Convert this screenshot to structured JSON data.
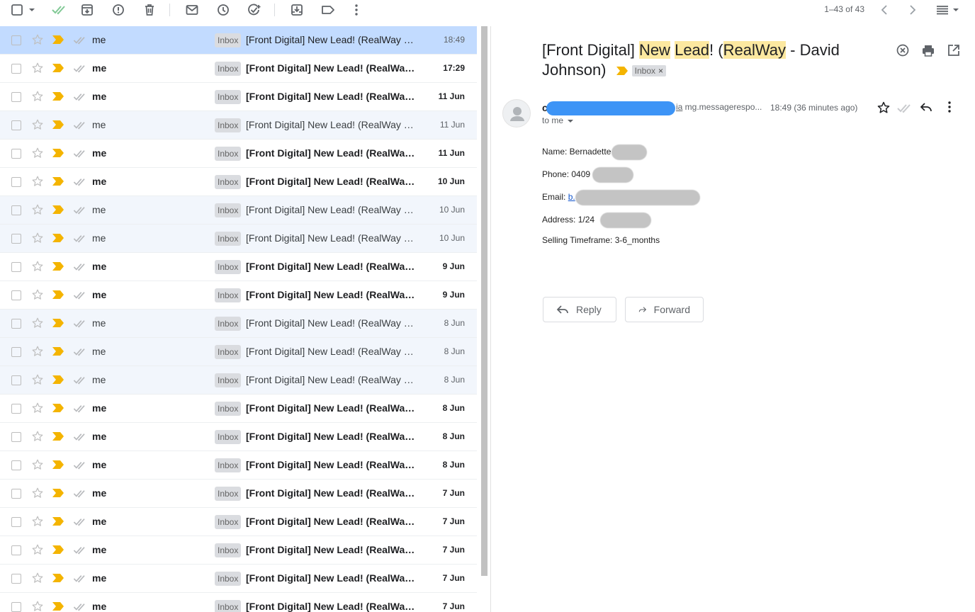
{
  "toolbar": {
    "pager_text": "1–43 of 43"
  },
  "emails": [
    {
      "sender": "me",
      "label": "Inbox",
      "subject": "[Front Digital] New Lead! (RealWay - David Johnson)",
      "date": "18:49",
      "state": "selected"
    },
    {
      "sender": "me",
      "label": "Inbox",
      "subject": "[Front Digital] New Lead! (RealWay - David Johnson)",
      "date": "17:29",
      "state": "unread"
    },
    {
      "sender": "me",
      "label": "Inbox",
      "subject": "[Front Digital] New Lead! (RealWay - David Johnson)",
      "date": "11 Jun",
      "state": "unread"
    },
    {
      "sender": "me",
      "label": "Inbox",
      "subject": "[Front Digital] New Lead! (RealWay - David Johnson)",
      "date": "11 Jun",
      "state": "read"
    },
    {
      "sender": "me",
      "label": "Inbox",
      "subject": "[Front Digital] New Lead! (RealWay - David Johnson)",
      "date": "11 Jun",
      "state": "unread"
    },
    {
      "sender": "me",
      "label": "Inbox",
      "subject": "[Front Digital] New Lead! (RealWay - David Johnson)",
      "date": "10 Jun",
      "state": "unread"
    },
    {
      "sender": "me",
      "label": "Inbox",
      "subject": "[Front Digital] New Lead! (RealWay - David Johnson)",
      "date": "10 Jun",
      "state": "read"
    },
    {
      "sender": "me",
      "label": "Inbox",
      "subject": "[Front Digital] New Lead! (RealWay - David Johnson)",
      "date": "10 Jun",
      "state": "read"
    },
    {
      "sender": "me",
      "label": "Inbox",
      "subject": "[Front Digital] New Lead! (RealWay - David Johnson)",
      "date": "9 Jun",
      "state": "unread"
    },
    {
      "sender": "me",
      "label": "Inbox",
      "subject": "[Front Digital] New Lead! (RealWay - David Johnson)",
      "date": "9 Jun",
      "state": "unread"
    },
    {
      "sender": "me",
      "label": "Inbox",
      "subject": "[Front Digital] New Lead! (RealWay - David Johnson)",
      "date": "8 Jun",
      "state": "read"
    },
    {
      "sender": "me",
      "label": "Inbox",
      "subject": "[Front Digital] New Lead! (RealWay - David Johnson)",
      "date": "8 Jun",
      "state": "read"
    },
    {
      "sender": "me",
      "label": "Inbox",
      "subject": "[Front Digital] New Lead! (RealWay - David Johnson)",
      "date": "8 Jun",
      "state": "read"
    },
    {
      "sender": "me",
      "label": "Inbox",
      "subject": "[Front Digital] New Lead! (RealWay - David Johnson)",
      "date": "8 Jun",
      "state": "unread"
    },
    {
      "sender": "me",
      "label": "Inbox",
      "subject": "[Front Digital] New Lead! (RealWay - David Johnson)",
      "date": "8 Jun",
      "state": "unread"
    },
    {
      "sender": "me",
      "label": "Inbox",
      "subject": "[Front Digital] New Lead! (RealWay - David Johnson)",
      "date": "8 Jun",
      "state": "unread"
    },
    {
      "sender": "me",
      "label": "Inbox",
      "subject": "[Front Digital] New Lead! (RealWay - David Johnson)",
      "date": "7 Jun",
      "state": "unread"
    },
    {
      "sender": "me",
      "label": "Inbox",
      "subject": "[Front Digital] New Lead! (RealWay - David Johnson)",
      "date": "7 Jun",
      "state": "unread"
    },
    {
      "sender": "me",
      "label": "Inbox",
      "subject": "[Front Digital] New Lead! (RealWay - David Johnson)",
      "date": "7 Jun",
      "state": "unread"
    },
    {
      "sender": "me",
      "label": "Inbox",
      "subject": "[Front Digital] New Lead! (RealWay - David Johnson)",
      "date": "7 Jun",
      "state": "unread"
    },
    {
      "sender": "me",
      "label": "Inbox",
      "subject": "[Front Digital] New Lead! (RealWay - David Johnson)",
      "date": "7 Jun",
      "state": "unread"
    }
  ],
  "reader": {
    "subject_prefix": "[Front Digital] ",
    "subject_hl1": "New",
    "subject_hl2": "Lead",
    "subject_mid": "! (",
    "subject_hl3": "RealWay",
    "subject_suffix": " - David Johnson)",
    "chip_label": "Inbox",
    "chip_close": "×",
    "from_visible": "c",
    "via_prefix": "ia",
    "via_domain": " mg.messagerespo...",
    "time": "18:49 (36 minutes ago)",
    "to": "to me",
    "body": {
      "name_label": "Name: Bernadette",
      "phone_label": "Phone: 0409",
      "email_label": "Email: ",
      "email_visible": "b.",
      "address_label": "Address: 1/24",
      "timeframe": "Selling Timeframe: 3-6_months"
    },
    "reply_label": "Reply",
    "forward_label": "Forward"
  },
  "colors": {
    "selected_row": "#c2dbff",
    "read_row": "#f2f6fc",
    "importance": "#f4b400",
    "highlight": "#fce8a0",
    "redaction_blue": "#3d94f6"
  }
}
